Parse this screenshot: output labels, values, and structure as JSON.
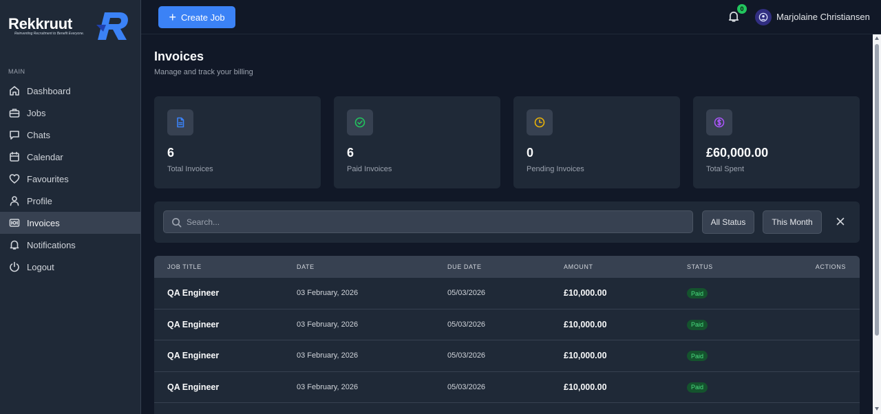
{
  "brand": {
    "name": "Rekkruut",
    "tagline": "Reinventing Recruitment to Benefit Everyone.",
    "accent": "#3b82f6"
  },
  "sidebar": {
    "section": "MAIN",
    "items": [
      {
        "label": "Dashboard",
        "icon": "home-icon"
      },
      {
        "label": "Jobs",
        "icon": "briefcase-icon"
      },
      {
        "label": "Chats",
        "icon": "chat-icon"
      },
      {
        "label": "Calendar",
        "icon": "calendar-icon"
      },
      {
        "label": "Favourites",
        "icon": "heart-icon"
      },
      {
        "label": "Profile",
        "icon": "user-icon"
      },
      {
        "label": "Invoices",
        "icon": "invoice-icon",
        "active": true
      },
      {
        "label": "Notifications",
        "icon": "bell-icon"
      },
      {
        "label": "Logout",
        "icon": "power-icon"
      }
    ]
  },
  "header": {
    "create_label": "Create Job",
    "notification_count": "0",
    "user_name": "Marjolaine Christiansen"
  },
  "page": {
    "title": "Invoices",
    "subtitle": "Manage and track your billing"
  },
  "stats": [
    {
      "value": "6",
      "label": "Total Invoices",
      "icon": "document-icon",
      "color": "#3b82f6"
    },
    {
      "value": "6",
      "label": "Paid Invoices",
      "icon": "check-circle-icon",
      "color": "#22c55e"
    },
    {
      "value": "0",
      "label": "Pending Invoices",
      "icon": "clock-icon",
      "color": "#eab308"
    },
    {
      "value": "£60,000.00",
      "label": "Total Spent",
      "icon": "dollar-circle-icon",
      "color": "#a855f7"
    }
  ],
  "filters": {
    "search_placeholder": "Search...",
    "status": "All Status",
    "period": "This Month"
  },
  "table": {
    "columns": [
      "JOB TITLE",
      "DATE",
      "DUE DATE",
      "AMOUNT",
      "STATUS",
      "ACTIONS"
    ],
    "rows": [
      {
        "title": "QA Engineer",
        "date": "03 February, 2026",
        "due": "05/03/2026",
        "amount": "£10,000.00",
        "status": "Paid"
      },
      {
        "title": "QA Engineer",
        "date": "03 February, 2026",
        "due": "05/03/2026",
        "amount": "£10,000.00",
        "status": "Paid"
      },
      {
        "title": "QA Engineer",
        "date": "03 February, 2026",
        "due": "05/03/2026",
        "amount": "£10,000.00",
        "status": "Paid"
      },
      {
        "title": "QA Engineer",
        "date": "03 February, 2026",
        "due": "05/03/2026",
        "amount": "£10,000.00",
        "status": "Paid"
      }
    ]
  }
}
